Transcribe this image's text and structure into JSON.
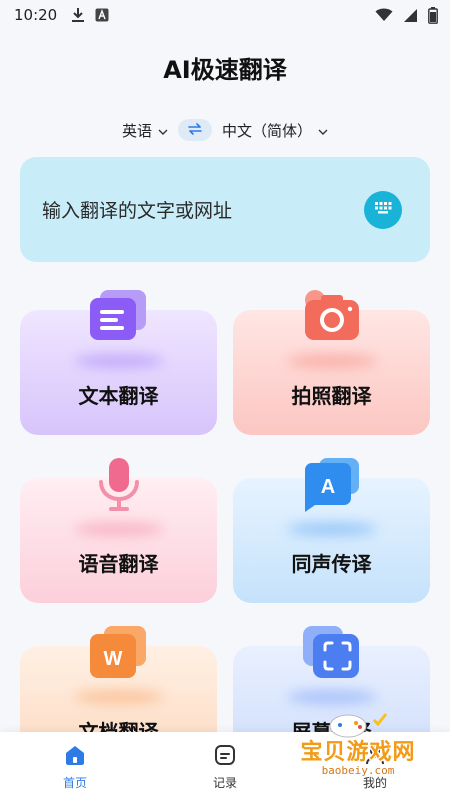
{
  "status_bar": {
    "time": "10:20",
    "icons": [
      "download-icon",
      "notification-app-icon",
      "wifi-icon",
      "signal-icon",
      "battery-icon"
    ]
  },
  "header": {
    "title": "AI极速翻译"
  },
  "language_bar": {
    "source_language": "英语",
    "target_language": "中文（简体）"
  },
  "input": {
    "placeholder": "输入翻译的文字或网址"
  },
  "features": [
    {
      "label": "文本翻译",
      "icon": "document-lines-icon",
      "color": "#8b5cf6"
    },
    {
      "label": "拍照翻译",
      "icon": "camera-icon",
      "color": "#f26b5b"
    },
    {
      "label": "语音翻译",
      "icon": "microphone-icon",
      "color": "#f06a8f"
    },
    {
      "label": "同声传译",
      "icon": "chat-bubble-a-icon",
      "color": "#2f8df0"
    },
    {
      "label": "文档翻译",
      "icon": "word-document-icon",
      "color": "#f58a3a"
    },
    {
      "label": "屏幕翻译",
      "icon": "screen-capture-icon",
      "color": "#4c7ef2"
    }
  ],
  "bottom_nav": {
    "items": [
      {
        "label": "首页",
        "icon": "home-icon",
        "active": true
      },
      {
        "label": "记录",
        "icon": "record-list-icon",
        "active": false
      },
      {
        "label": "我的",
        "icon": "profile-icon",
        "active": false
      }
    ]
  },
  "watermark": {
    "text": "宝贝游戏网",
    "url": "baobeiy.com"
  },
  "colors": {
    "accent": "#2e7be8",
    "input_bg": "#c9edf8",
    "keyboard_button": "#19b3d8"
  }
}
